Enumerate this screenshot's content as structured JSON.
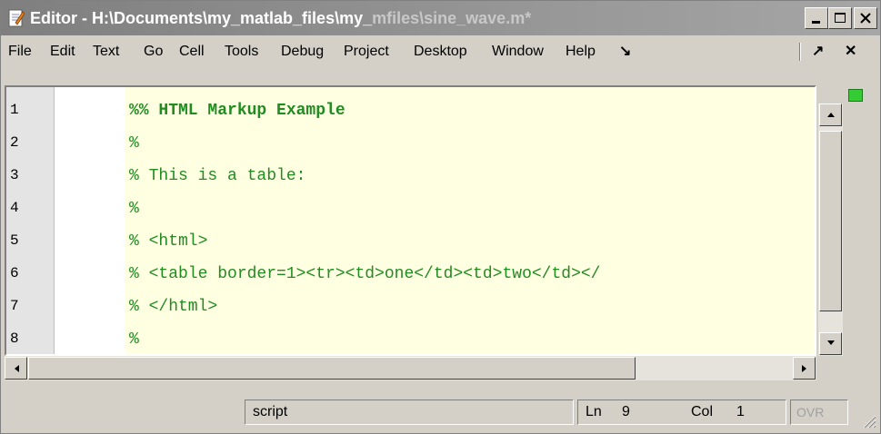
{
  "window": {
    "title_prefix": "Editor - H:\\Documents\\my_matlab_files\\my_",
    "title_suffix": "mfiles\\sine_wave.m*"
  },
  "menu": {
    "items": [
      "File",
      "Edit",
      "Text",
      "Go",
      "Cell",
      "Tools",
      "Debug",
      "Project",
      "Desktop",
      "Window",
      "Help"
    ]
  },
  "editor": {
    "line_numbers": [
      "1",
      "2",
      "3",
      "4",
      "5",
      "6",
      "7",
      "8"
    ],
    "lines": [
      "%% HTML Markup Example",
      "%",
      "% This is a table:",
      "%",
      "% <html>",
      "% <table border=1><tr><td>one</td><td>two</td></",
      "% </html>",
      "%"
    ]
  },
  "status": {
    "mode": "script",
    "ln_label": "Ln",
    "ln_value": "9",
    "col_label": "Col",
    "col_value": "1",
    "ovr": "OVR"
  },
  "colors": {
    "comment": "#228b22",
    "cell_background": "#ffffe1"
  }
}
